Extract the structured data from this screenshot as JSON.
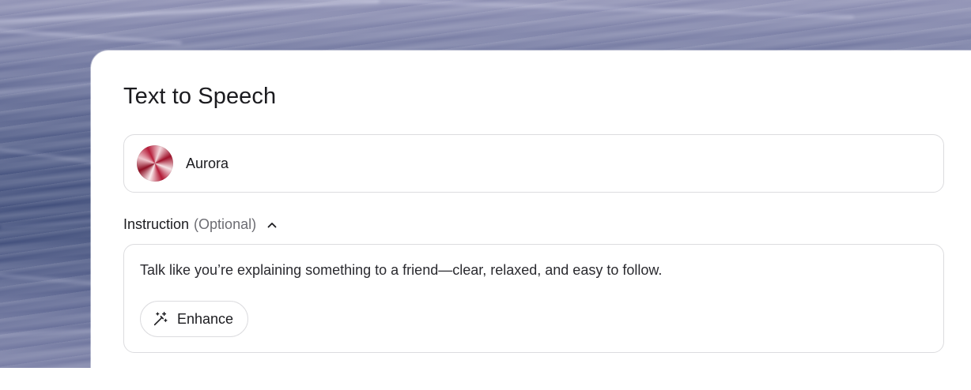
{
  "app": {
    "title": "Text to Speech"
  },
  "voice": {
    "name": "Aurora",
    "avatar_icon": "voice-avatar-icon",
    "accent_colors": [
      "#a0112a",
      "#f6e3e6"
    ]
  },
  "instruction": {
    "label": "Instruction",
    "optional_label": "(Optional)",
    "toggle_icon": "chevron-up-icon",
    "value": "Talk like you’re explaining something to a friend—clear, relaxed, and easy to follow.",
    "enhance_button": {
      "label": "Enhance",
      "icon": "magic-wand-icon"
    }
  }
}
